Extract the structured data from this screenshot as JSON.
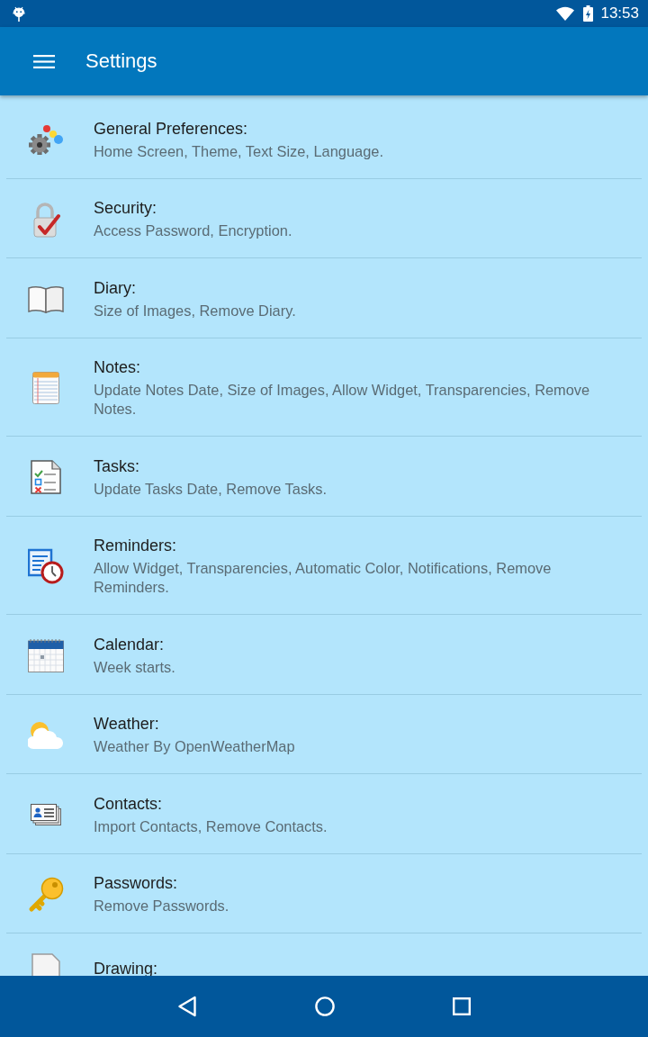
{
  "status_bar": {
    "time": "13:53"
  },
  "app_bar": {
    "title": "Settings"
  },
  "settings": [
    {
      "title": "General Preferences:",
      "summary": "Home Screen, Theme, Text Size, Language."
    },
    {
      "title": "Security:",
      "summary": "Access Password, Encryption."
    },
    {
      "title": "Diary:",
      "summary": "Size of Images, Remove Diary."
    },
    {
      "title": "Notes:",
      "summary": "Update Notes Date, Size of Images, Allow Widget, Transparencies, Remove Notes."
    },
    {
      "title": "Tasks:",
      "summary": "Update Tasks Date, Remove Tasks."
    },
    {
      "title": "Reminders:",
      "summary": "Allow Widget, Transparencies, Automatic Color, Notifications, Remove Reminders."
    },
    {
      "title": "Calendar:",
      "summary": "Week starts."
    },
    {
      "title": "Weather:",
      "summary": "Weather By OpenWeatherMap"
    },
    {
      "title": "Contacts:",
      "summary": "Import Contacts, Remove Contacts."
    },
    {
      "title": "Passwords:",
      "summary": "Remove Passwords."
    },
    {
      "title": "Drawing:"
    }
  ]
}
